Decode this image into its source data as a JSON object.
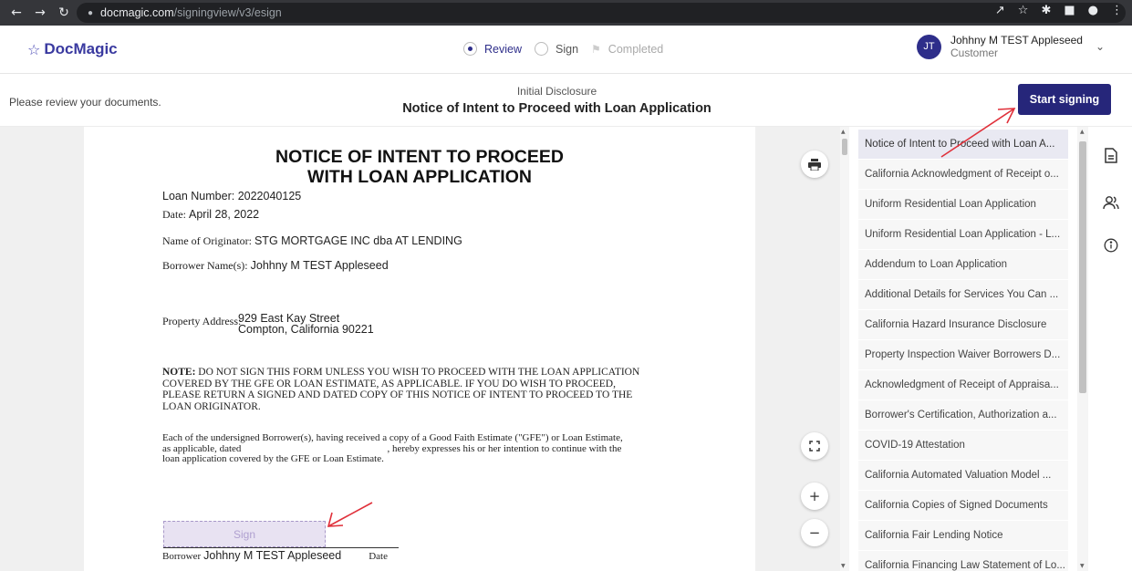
{
  "browser": {
    "host": "docmagic.com",
    "path": "/signingview/v3/esign"
  },
  "app": {
    "logo_text": "DocMagic",
    "steps": [
      {
        "label": "Review",
        "state": "active"
      },
      {
        "label": "Sign",
        "state": "pending"
      },
      {
        "label": "Completed",
        "state": "disabled"
      }
    ],
    "user": {
      "initials": "JT",
      "name": "Johhny M TEST Appleseed",
      "role": "Customer"
    }
  },
  "subbar": {
    "instruction": "Please review your documents.",
    "doc_type": "Initial Disclosure",
    "doc_title": "Notice of Intent to Proceed with Loan Application",
    "start_signing_label": "Start signing"
  },
  "document": {
    "title_line1": "NOTICE OF INTENT TO PROCEED",
    "title_line2": "WITH LOAN APPLICATION",
    "loan_number_label": "Loan Number:",
    "loan_number": "2022040125",
    "date_label": "Date:",
    "date": "April 28, 2022",
    "originator_label": "Name of Originator:",
    "originator": "STG MORTGAGE INC dba AT LENDING",
    "borrower_label": "Borrower Name(s):",
    "borrower": "Johhny M TEST Appleseed",
    "property_label": "Property Address:",
    "property_line1": "929 East Kay Street",
    "property_line2": "Compton, California 90221",
    "note_bold": "NOTE:",
    "note_line1": "DO NOT SIGN THIS FORM UNLESS YOU WISH TO PROCEED WITH THE LOAN APPLICATION",
    "note_line2": "COVERED BY THE GFE OR LOAN ESTIMATE, AS APPLICABLE.  IF YOU DO WISH TO PROCEED,",
    "note_line3": "PLEASE RETURN A SIGNED AND DATED COPY OF THIS NOTICE OF INTENT TO PROCEED TO THE",
    "note_line4": "LOAN ORIGINATOR.",
    "body_line1": "Each of the undersigned Borrower(s), having received a copy of a Good Faith Estimate (\"GFE\") or Loan Estimate,",
    "body_line2a": "as applicable, dated",
    "body_line2b": ", hereby expresses his or her intention to continue with the",
    "body_line3": "loan application covered by the GFE or Loan Estimate.",
    "sign_field_label": "Sign",
    "borrower_sig_label": "Borrower",
    "borrower_sig_name": "Johhny M TEST Appleseed",
    "date_sig_label": "Date"
  },
  "doc_list": [
    "Notice of Intent to Proceed with Loan A...",
    "California Acknowledgment of Receipt o...",
    "Uniform Residential Loan Application",
    "Uniform Residential Loan Application - L...",
    "Addendum to Loan Application",
    "Additional Details for Services You Can ...",
    "California Hazard Insurance Disclosure",
    "Property Inspection Waiver Borrowers D...",
    "Acknowledgment of Receipt of Appraisa...",
    "Borrower's Certification, Authorization a...",
    "COVID-19 Attestation",
    "California Automated Valuation Model ...",
    "California Copies of Signed Documents",
    "California Fair Lending Notice",
    "California Financing Law Statement of Lo..."
  ],
  "icons": {
    "print": "print-icon",
    "fullscreen": "fullscreen-icon",
    "zoom_in": "zoom-in-icon",
    "zoom_out": "zoom-out-icon",
    "rail_document": "document-icon",
    "rail_signers": "users-icon",
    "rail_info": "info-icon"
  },
  "colors": {
    "brand": "#26267a",
    "annotation_arrow": "#e0303a",
    "sign_field": "#e8e2f2"
  }
}
